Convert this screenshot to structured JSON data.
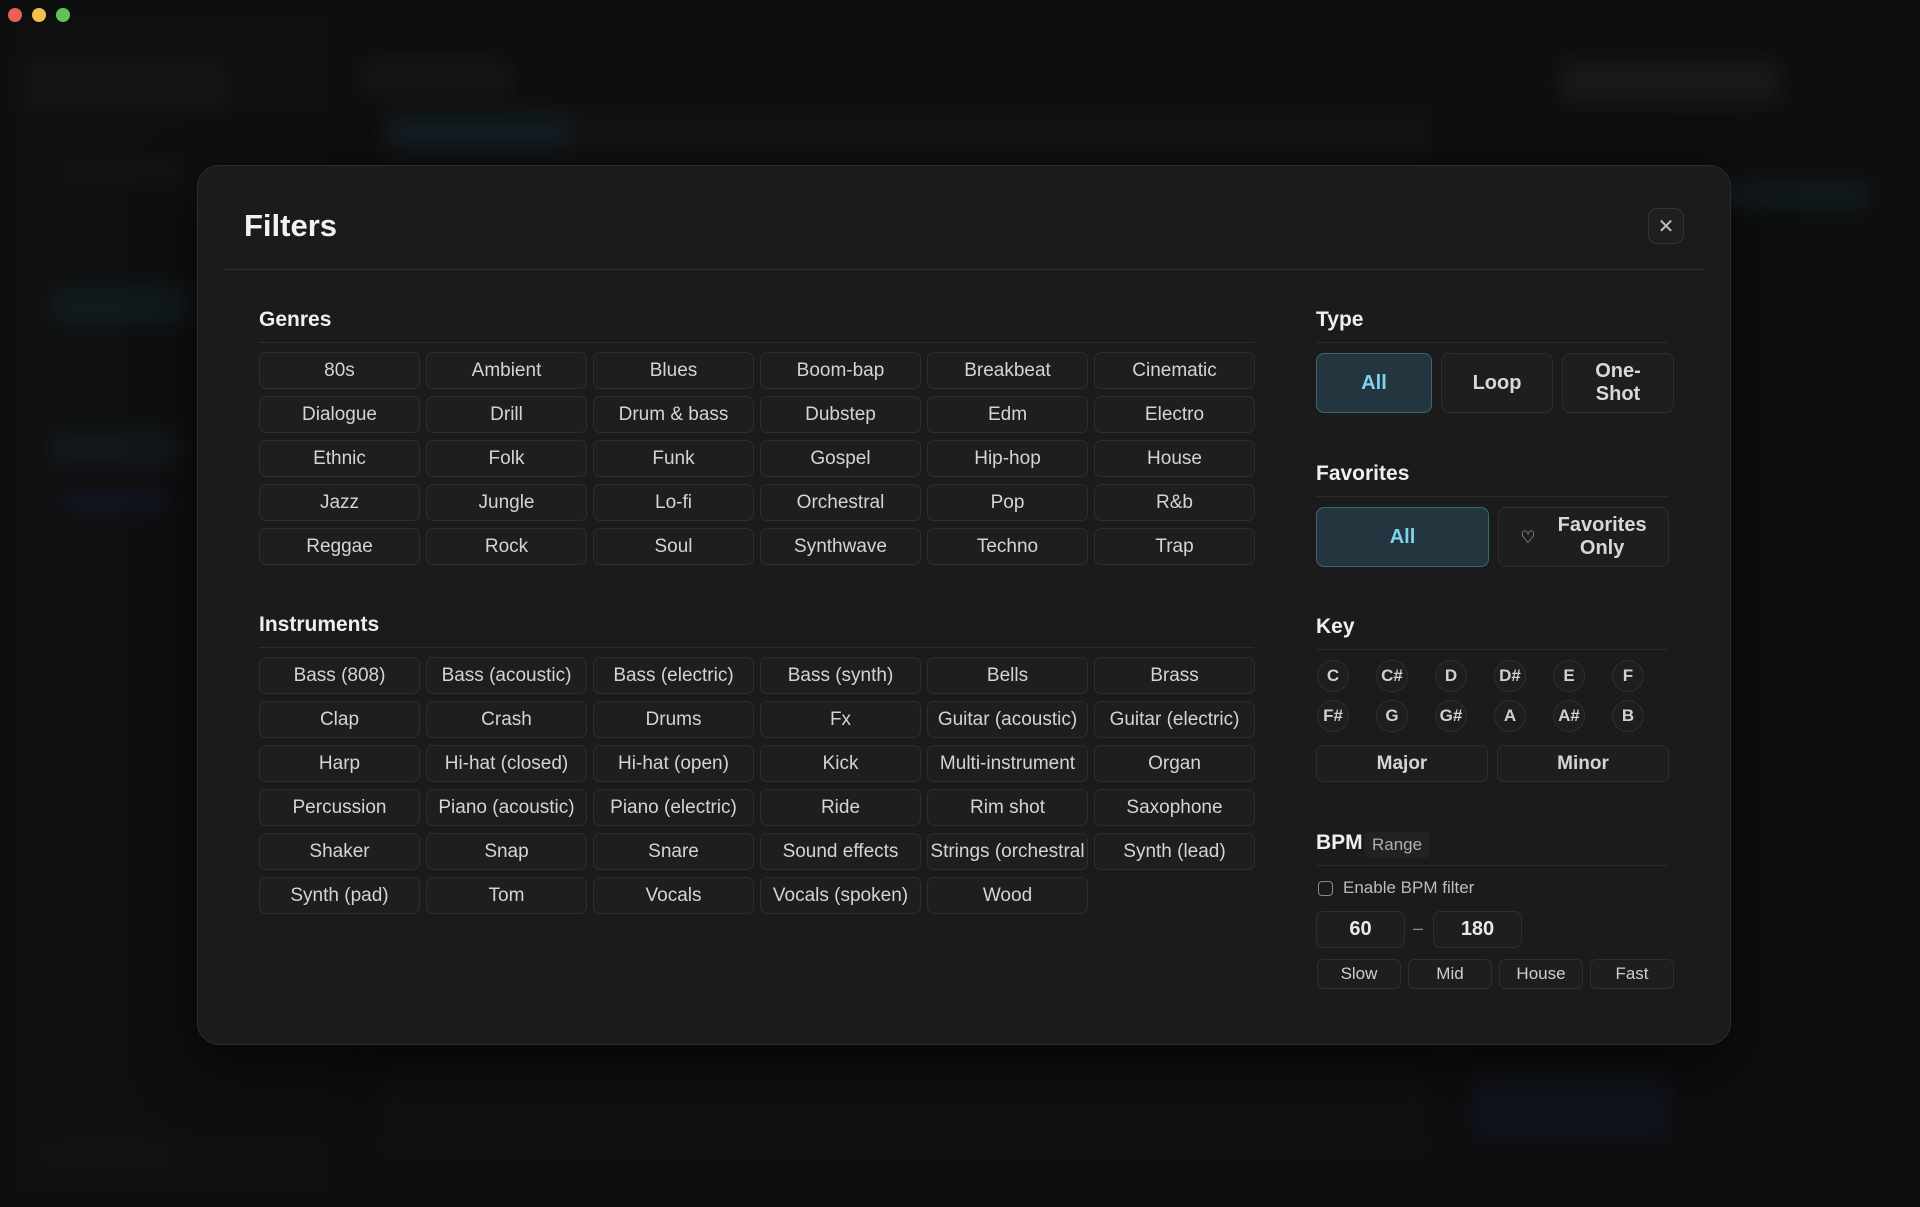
{
  "window": {
    "controls": [
      "close",
      "minimize",
      "zoom"
    ]
  },
  "modal": {
    "title": "Filters",
    "close_icon": "close-icon"
  },
  "genres": {
    "title": "Genres",
    "items": [
      "80s",
      "Ambient",
      "Blues",
      "Boom-bap",
      "Breakbeat",
      "Cinematic",
      "Dialogue",
      "Drill",
      "Drum & bass",
      "Dubstep",
      "Edm",
      "Electro",
      "Ethnic",
      "Folk",
      "Funk",
      "Gospel",
      "Hip-hop",
      "House",
      "Jazz",
      "Jungle",
      "Lo-fi",
      "Orchestral",
      "Pop",
      "R&b",
      "Reggae",
      "Rock",
      "Soul",
      "Synthwave",
      "Techno",
      "Trap"
    ]
  },
  "instruments": {
    "title": "Instruments",
    "items": [
      "Bass (808)",
      "Bass (acoustic)",
      "Bass (electric)",
      "Bass (synth)",
      "Bells",
      "Brass",
      "Clap",
      "Crash",
      "Drums",
      "Fx",
      "Guitar (acoustic)",
      "Guitar (electric)",
      "Harp",
      "Hi-hat (closed)",
      "Hi-hat (open)",
      "Kick",
      "Multi-instrument",
      "Organ",
      "Percussion",
      "Piano (acoustic)",
      "Piano (electric)",
      "Ride",
      "Rim shot",
      "Saxophone",
      "Shaker",
      "Snap",
      "Snare",
      "Sound effects",
      "Strings (orchestral",
      "Synth (lead)",
      "Synth (pad)",
      "Tom",
      "Vocals",
      "Vocals (spoken)",
      "Wood"
    ]
  },
  "type": {
    "title": "Type",
    "options": [
      "All",
      "Loop",
      "One-\nShot"
    ],
    "selected": "All"
  },
  "favorites": {
    "title": "Favorites",
    "all_label": "All",
    "only_label": "Favorites\nOnly",
    "heart_icon": "heart-icon",
    "selected": "All"
  },
  "key": {
    "title": "Key",
    "notes": [
      "C",
      "C#",
      "D",
      "D#",
      "E",
      "F",
      "F#",
      "G",
      "G#",
      "A",
      "A#",
      "B"
    ],
    "modes": [
      "Major",
      "Minor"
    ]
  },
  "bpm": {
    "title": "BPM",
    "range_tag": "Range",
    "enable_label": "Enable BPM filter",
    "enabled": false,
    "min": "60",
    "max": "180",
    "separator": "–",
    "presets": [
      "Slow",
      "Mid",
      "House",
      "Fast"
    ]
  },
  "colors": {
    "accent": "#7fd3ee",
    "accent_bg": "#23363f",
    "modal_bg": "#1b1b1b"
  }
}
